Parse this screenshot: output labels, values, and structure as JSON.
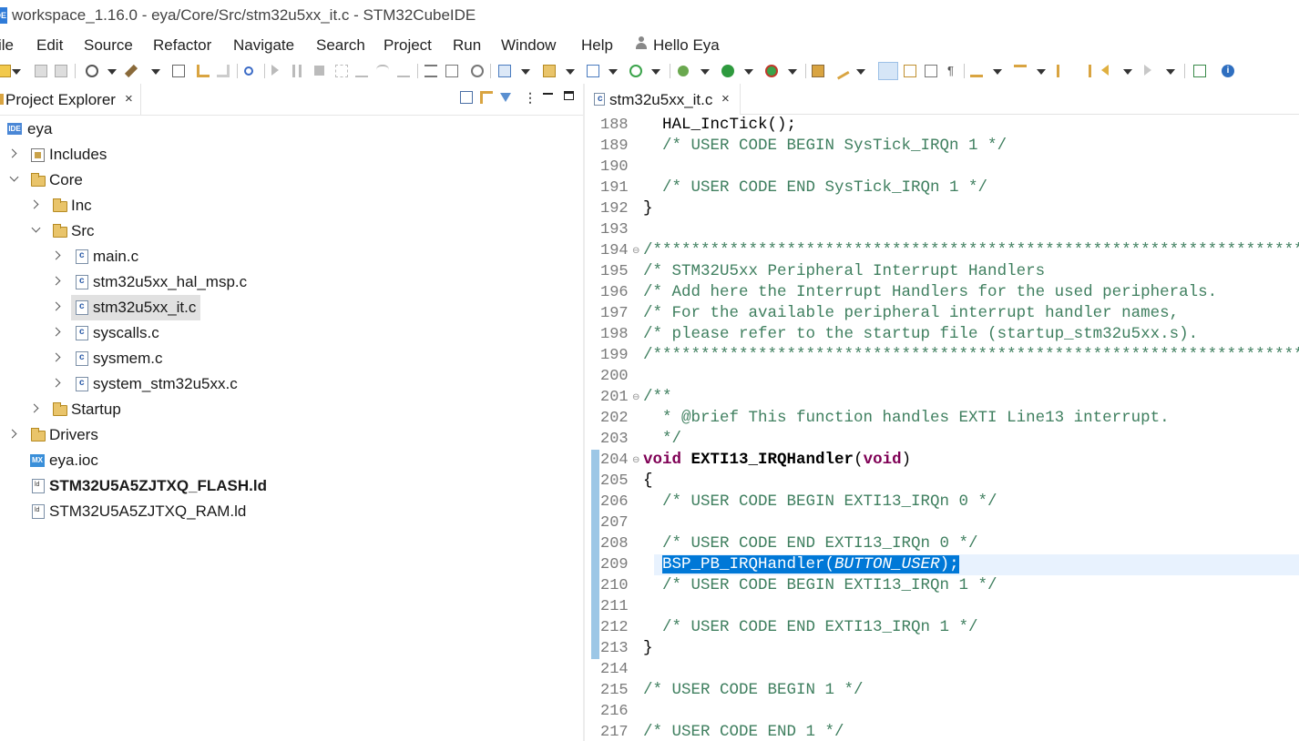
{
  "window": {
    "app_icon": "IDE",
    "title": "workspace_1.16.0 - eya/Core/Src/stm32u5xx_it.c - STM32CubeIDE"
  },
  "menu": {
    "items": [
      "ile",
      "Edit",
      "Source",
      "Refactor",
      "Navigate",
      "Search",
      "Project",
      "Run",
      "Window",
      "Help"
    ],
    "user": "Hello Eya"
  },
  "project_explorer": {
    "tab_label": "Project Explorer",
    "close_glyph": "×",
    "tree": [
      {
        "label": "eya",
        "icon": "ide-project-icon",
        "expander": "none",
        "bold": false
      },
      {
        "label": "Includes",
        "icon": "includes-icon",
        "expander": "collapsed",
        "bold": false
      },
      {
        "label": "Core",
        "icon": "folder-icon",
        "expander": "expanded",
        "bold": false
      },
      {
        "label": "Inc",
        "icon": "folder-icon",
        "expander": "collapsed",
        "bold": false
      },
      {
        "label": "Src",
        "icon": "folder-icon",
        "expander": "expanded",
        "bold": false
      },
      {
        "label": "main.c",
        "icon": "c-file-icon",
        "expander": "collapsed",
        "bold": false
      },
      {
        "label": "stm32u5xx_hal_msp.c",
        "icon": "c-file-icon",
        "expander": "collapsed",
        "bold": false
      },
      {
        "label": "stm32u5xx_it.c",
        "icon": "c-file-icon",
        "expander": "collapsed",
        "bold": false,
        "selected": true
      },
      {
        "label": "syscalls.c",
        "icon": "c-file-icon",
        "expander": "collapsed",
        "bold": false
      },
      {
        "label": "sysmem.c",
        "icon": "c-file-icon",
        "expander": "collapsed",
        "bold": false
      },
      {
        "label": "system_stm32u5xx.c",
        "icon": "c-file-icon",
        "expander": "collapsed",
        "bold": false
      },
      {
        "label": "Startup",
        "icon": "folder-icon",
        "expander": "collapsed",
        "bold": false
      },
      {
        "label": "Drivers",
        "icon": "folder-icon",
        "expander": "collapsed",
        "bold": false
      },
      {
        "label": "eya.ioc",
        "icon": "mx-file-icon",
        "expander": "none",
        "bold": false
      },
      {
        "label": "STM32U5A5ZJTXQ_FLASH.ld",
        "icon": "ld-file-icon",
        "expander": "none",
        "bold": true
      },
      {
        "label": "STM32U5A5ZJTXQ_RAM.ld",
        "icon": "ld-file-icon",
        "expander": "none",
        "bold": false
      }
    ]
  },
  "editor": {
    "tab_label": "stm32u5xx_it.c",
    "close_glyph": "×",
    "lines": [
      {
        "n": "188",
        "text": "  HAL_IncTick();"
      },
      {
        "n": "189",
        "text": "  /* USER CODE BEGIN SysTick_IRQn 1 */"
      },
      {
        "n": "190",
        "text": ""
      },
      {
        "n": "191",
        "text": "  /* USER CODE END SysTick_IRQn 1 */"
      },
      {
        "n": "192",
        "text": "}"
      },
      {
        "n": "193",
        "text": ""
      },
      {
        "n": "194",
        "text": "/******************************************************************************"
      },
      {
        "n": "195",
        "text": "/* STM32U5xx Peripheral Interrupt Handlers"
      },
      {
        "n": "196",
        "text": "/* Add here the Interrupt Handlers for the used peripherals."
      },
      {
        "n": "197",
        "text": "/* For the available peripheral interrupt handler names,"
      },
      {
        "n": "198",
        "text": "/* please refer to the startup file (startup_stm32u5xx.s)."
      },
      {
        "n": "199",
        "text": "/******************************************************************************"
      },
      {
        "n": "200",
        "text": ""
      },
      {
        "n": "201",
        "text": "/**"
      },
      {
        "n": "202",
        "text": "  * @brief This function handles EXTI Line13 interrupt."
      },
      {
        "n": "203",
        "text": "  */"
      },
      {
        "n": "204",
        "text": "void EXTI13_IRQHandler(void)"
      },
      {
        "n": "205",
        "text": "{"
      },
      {
        "n": "206",
        "text": "  /* USER CODE BEGIN EXTI13_IRQn 0 */"
      },
      {
        "n": "207",
        "text": ""
      },
      {
        "n": "208",
        "text": "  /* USER CODE END EXTI13_IRQn 0 */"
      },
      {
        "n": "209",
        "text": "  BSP_PB_IRQHandler(BUTTON_USER);"
      },
      {
        "n": "210",
        "text": "  /* USER CODE BEGIN EXTI13_IRQn 1 */"
      },
      {
        "n": "211",
        "text": ""
      },
      {
        "n": "212",
        "text": "  /* USER CODE END EXTI13_IRQn 1 */"
      },
      {
        "n": "213",
        "text": "}"
      },
      {
        "n": "214",
        "text": ""
      },
      {
        "n": "215",
        "text": "/* USER CODE BEGIN 1 */"
      },
      {
        "n": "216",
        "text": ""
      },
      {
        "n": "217",
        "text": "/* USER CODE END 1 */"
      }
    ]
  },
  "colors": {
    "comment": "#3f7f5f",
    "keyword": "#7f0055",
    "selection": "#0078d7",
    "current_line": "#e8f2fe",
    "change_bar": "#9dc7e6"
  }
}
